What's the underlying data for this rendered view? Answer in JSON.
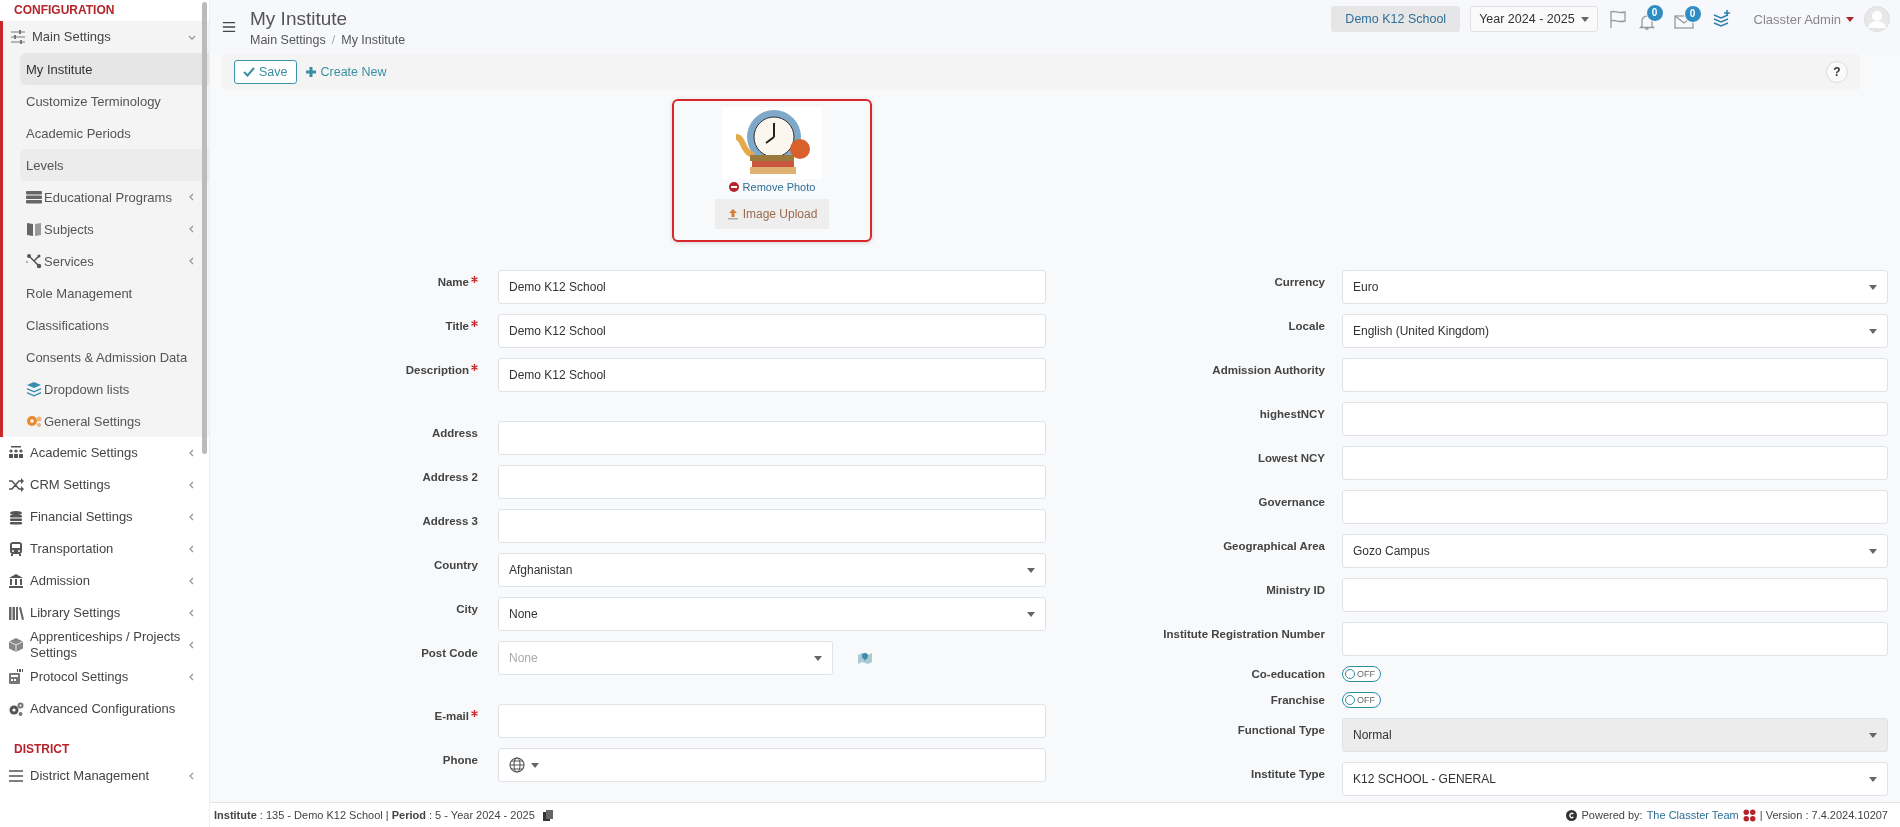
{
  "sidebar": {
    "sections": [
      {
        "title": "CONFIGURATION",
        "items": [
          {
            "label": "Main Settings",
            "has_submenu": true,
            "expanded": true,
            "children": [
              {
                "label": "My Institute",
                "selected": true,
                "hovered": false,
                "has_submenu": false
              },
              {
                "label": "Customize Terminology",
                "selected": false,
                "hovered": false,
                "has_submenu": false
              },
              {
                "label": "Academic Periods",
                "selected": false,
                "hovered": false,
                "has_submenu": false
              },
              {
                "label": "Levels",
                "selected": false,
                "hovered": true,
                "has_submenu": false
              },
              {
                "label": "Educational Programs",
                "selected": false,
                "hovered": false,
                "has_submenu": true
              },
              {
                "label": "Subjects",
                "selected": false,
                "hovered": false,
                "has_submenu": true
              },
              {
                "label": "Services",
                "selected": false,
                "hovered": false,
                "has_submenu": true
              },
              {
                "label": "Role Management",
                "selected": false,
                "hovered": false,
                "has_submenu": false
              },
              {
                "label": "Classifications",
                "selected": false,
                "hovered": false,
                "has_submenu": false
              },
              {
                "label": "Consents & Admission Data",
                "selected": false,
                "hovered": false,
                "has_submenu": false
              },
              {
                "label": "Dropdown lists",
                "selected": false,
                "hovered": false,
                "has_submenu": false
              },
              {
                "label": "General Settings",
                "selected": false,
                "hovered": false,
                "has_submenu": false
              }
            ]
          },
          {
            "label": "Academic Settings",
            "has_submenu": true,
            "expanded": false
          },
          {
            "label": "CRM Settings",
            "has_submenu": true,
            "expanded": false
          },
          {
            "label": "Financial Settings",
            "has_submenu": true,
            "expanded": false
          },
          {
            "label": "Transportation",
            "has_submenu": true,
            "expanded": false
          },
          {
            "label": "Admission",
            "has_submenu": true,
            "expanded": false
          },
          {
            "label": "Library Settings",
            "has_submenu": true,
            "expanded": false
          },
          {
            "label": "Apprenticeships / Projects Settings",
            "has_submenu": true,
            "expanded": false
          },
          {
            "label": "Protocol Settings",
            "has_submenu": true,
            "expanded": false
          },
          {
            "label": "Advanced Configurations",
            "has_submenu": false,
            "expanded": false
          }
        ]
      },
      {
        "title": "DISTRICT",
        "items": [
          {
            "label": "District Management",
            "has_submenu": true,
            "expanded": false
          }
        ]
      }
    ]
  },
  "header": {
    "title": "My Institute",
    "breadcrumb": [
      "Main Settings",
      "My Institute"
    ],
    "breadcrumb_separator": "/",
    "school_button": "Demo K12 School",
    "year_select": "Year 2024 - 2025",
    "notifications_badge": "0",
    "messages_badge": "0",
    "user_name": "Classter Admin"
  },
  "toolbar": {
    "save_button": "Save",
    "create_new_link": "Create New",
    "help_button": "?"
  },
  "photo": {
    "remove_photo_link": "Remove Photo",
    "upload_button": "Image Upload"
  },
  "form": {
    "left_groups": [
      [
        {
          "label": "Name",
          "required": true,
          "kind": "text",
          "value": "Demo K12 School",
          "disabled": false
        },
        {
          "label": "Title",
          "required": true,
          "kind": "text",
          "value": "Demo K12 School",
          "disabled": false
        },
        {
          "label": "Description",
          "required": true,
          "kind": "text",
          "value": "Demo K12 School",
          "disabled": false
        }
      ],
      [
        {
          "label": "Address",
          "required": false,
          "kind": "text",
          "disabled": false
        },
        {
          "label": "Address 2",
          "required": false,
          "kind": "text",
          "disabled": false
        },
        {
          "label": "Address 3",
          "required": false,
          "kind": "text",
          "disabled": false
        },
        {
          "label": "Country",
          "required": false,
          "kind": "select",
          "value": "Afghanistan",
          "disabled": false
        },
        {
          "label": "City",
          "required": false,
          "kind": "select",
          "value": "None",
          "disabled": false
        },
        {
          "label": "Post Code",
          "required": false,
          "kind": "postcode",
          "placeholder": "None",
          "disabled": false
        }
      ],
      [
        {
          "label": "E-mail",
          "required": true,
          "kind": "text",
          "disabled": false
        },
        {
          "label": "Phone",
          "required": false,
          "kind": "phone",
          "disabled": false
        }
      ]
    ],
    "right_fields": [
      {
        "label": "Currency",
        "required": false,
        "kind": "select",
        "value": "Euro",
        "disabled": false
      },
      {
        "label": "Locale",
        "required": false,
        "kind": "select",
        "value": "English (United Kingdom)",
        "disabled": false
      },
      {
        "label": "Admission Authority",
        "required": false,
        "kind": "text",
        "disabled": false
      },
      {
        "label": "highestNCY",
        "required": false,
        "kind": "text",
        "disabled": false
      },
      {
        "label": "Lowest NCY",
        "required": false,
        "kind": "text",
        "disabled": false
      },
      {
        "label": "Governance",
        "required": false,
        "kind": "text",
        "disabled": false
      },
      {
        "label": "Geographical Area",
        "required": false,
        "kind": "select",
        "value": "Gozo Campus",
        "disabled": false
      },
      {
        "label": "Ministry ID",
        "required": false,
        "kind": "text",
        "disabled": false
      },
      {
        "label": "Institute Registration Number",
        "required": false,
        "kind": "text",
        "disabled": false
      },
      {
        "label": "Co-education",
        "required": false,
        "kind": "toggle",
        "on": false,
        "state_text": "OFF",
        "disabled": false
      },
      {
        "label": "Franchise",
        "required": false,
        "kind": "toggle",
        "on": false,
        "state_text": "OFF",
        "disabled": false
      },
      {
        "label": "Functional Type",
        "required": false,
        "kind": "select",
        "value": "Normal",
        "disabled": true
      },
      {
        "label": "Institute Type",
        "required": false,
        "kind": "select",
        "value": "K12 SCHOOL - GENERAL",
        "disabled": false
      }
    ]
  },
  "status_bar": {
    "info": "**Institute** : 135 - Demo K12 School | **Period** : 5 - Year 2024 - 2025",
    "powered_by": "Powered by:",
    "team_link": "The Classter Team",
    "version": "| Version : 7.4.2024.10207"
  }
}
